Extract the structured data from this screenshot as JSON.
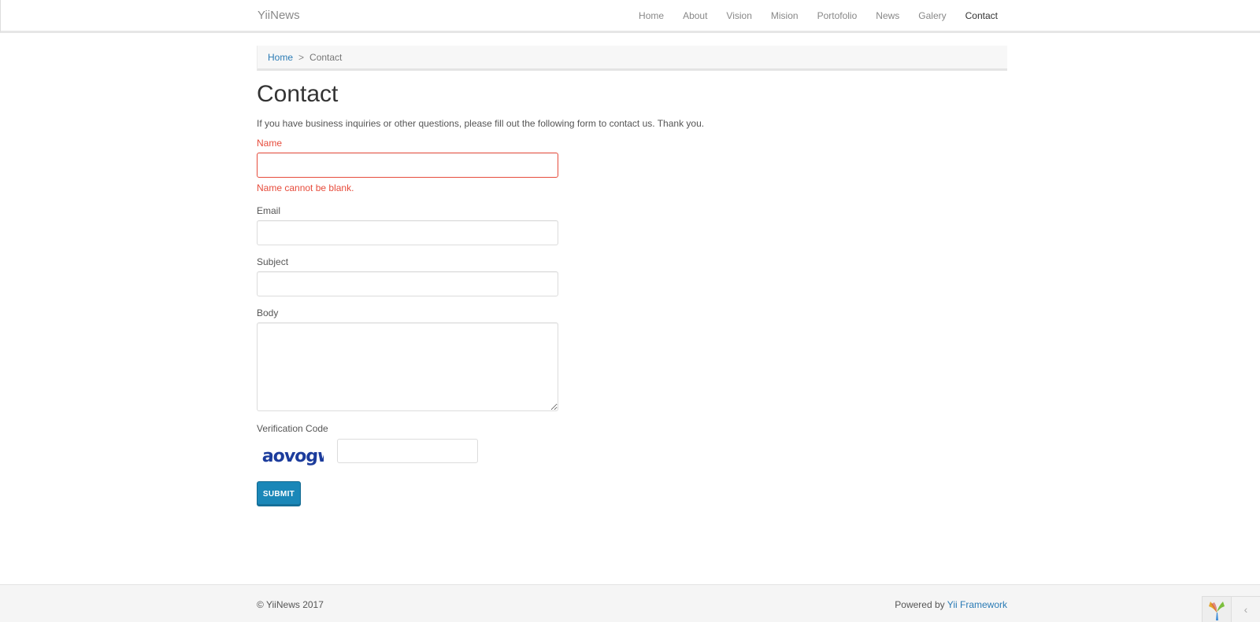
{
  "navbar": {
    "brand": "YiiNews",
    "items": [
      {
        "label": "Home",
        "active": false
      },
      {
        "label": "About",
        "active": false
      },
      {
        "label": "Vision",
        "active": false
      },
      {
        "label": "Mision",
        "active": false
      },
      {
        "label": "Portofolio",
        "active": false
      },
      {
        "label": "News",
        "active": false
      },
      {
        "label": "Galery",
        "active": false
      },
      {
        "label": "Contact",
        "active": true
      }
    ]
  },
  "breadcrumb": {
    "home": "Home",
    "separator": ">",
    "current": "Contact"
  },
  "page": {
    "title": "Contact",
    "intro": "If you have business inquiries or other questions, please fill out the following form to contact us. Thank you."
  },
  "form": {
    "name_label": "Name",
    "name_value": "",
    "name_error": "Name cannot be blank.",
    "email_label": "Email",
    "email_value": "",
    "subject_label": "Subject",
    "subject_value": "",
    "body_label": "Body",
    "body_value": "",
    "verify_label": "Verification Code",
    "captcha_text": "aovogw",
    "verify_value": "",
    "submit_label": "SUBMIT"
  },
  "footer": {
    "copyright": "© YiiNews 2017",
    "powered_prefix": "Powered by ",
    "powered_link": "Yii Framework"
  },
  "colors": {
    "link": "#2a7bb5",
    "error": "#e74c3c",
    "button": "#1a87b8"
  },
  "icons": {
    "debug_logo": "yii-logo-icon",
    "debug_toggle": "chevron-left-icon"
  }
}
